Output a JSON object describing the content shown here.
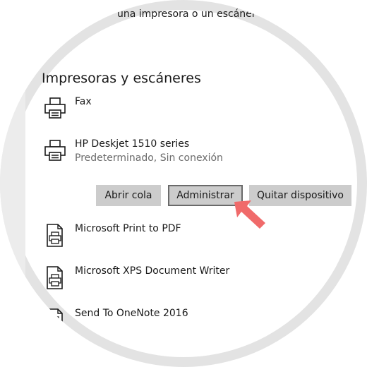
{
  "header": {
    "add_link": "una impresora o un escáner"
  },
  "section": {
    "title": "Impresoras y escáneres"
  },
  "devices": [
    {
      "name": "Fax",
      "status": "",
      "icon": "printer-icon"
    },
    {
      "name": "HP Deskjet 1510 series",
      "status": "Predeterminado, Sin conexión",
      "icon": "printer-icon"
    },
    {
      "name": "Microsoft Print to PDF",
      "status": "",
      "icon": "document-printer-icon"
    },
    {
      "name": "Microsoft XPS Document Writer",
      "status": "",
      "icon": "document-printer-icon"
    },
    {
      "name": "Send To OneNote 2016",
      "status": "",
      "icon": "document-printer-icon"
    }
  ],
  "actions": {
    "open_queue": "Abrir cola",
    "manage": "Administrar",
    "remove_device": "Quitar dispositivo"
  },
  "colors": {
    "button_bg": "#cccccc",
    "focus_border": "#6a6a6a",
    "annotation_arrow": "#f06a6a",
    "secondary_text": "#6b6b6b"
  }
}
